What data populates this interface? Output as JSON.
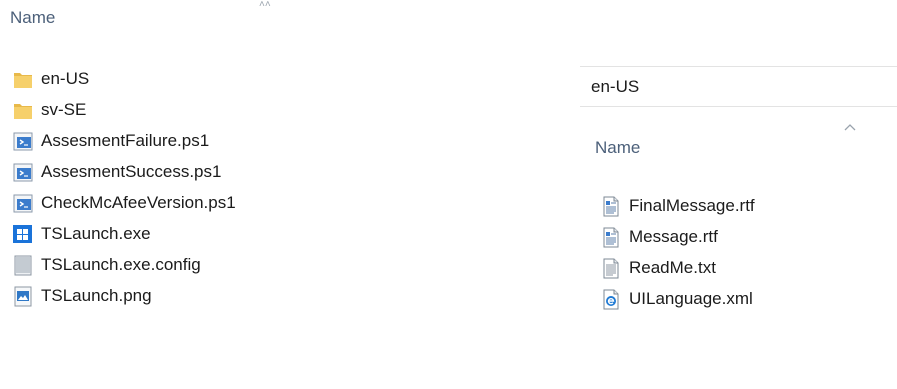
{
  "left_pane": {
    "column_name": "Name",
    "items": [
      {
        "label": "en-US",
        "icon": "folder-icon"
      },
      {
        "label": "sv-SE",
        "icon": "folder-icon"
      },
      {
        "label": "AssesmentFailure.ps1",
        "icon": "powershell-script-icon"
      },
      {
        "label": "AssesmentSuccess.ps1",
        "icon": "powershell-script-icon"
      },
      {
        "label": "CheckMcAfeeVersion.ps1",
        "icon": "powershell-script-icon"
      },
      {
        "label": "TSLaunch.exe",
        "icon": "windows-exe-icon"
      },
      {
        "label": "TSLaunch.exe.config",
        "icon": "config-file-icon"
      },
      {
        "label": "TSLaunch.png",
        "icon": "image-file-icon"
      }
    ]
  },
  "right_pane": {
    "title": "en-US",
    "column_name": "Name",
    "items": [
      {
        "label": "FinalMessage.rtf",
        "icon": "rich-text-document-icon"
      },
      {
        "label": "Message.rtf",
        "icon": "rich-text-document-icon"
      },
      {
        "label": "ReadMe.txt",
        "icon": "text-file-icon"
      },
      {
        "label": "UILanguage.xml",
        "icon": "xml-browser-file-icon"
      }
    ]
  },
  "colors": {
    "header_text": "#4c607a",
    "folder": "#f3cb5c",
    "ps_blue": "#2f6fb6",
    "windows_blue": "#1a73d9"
  }
}
